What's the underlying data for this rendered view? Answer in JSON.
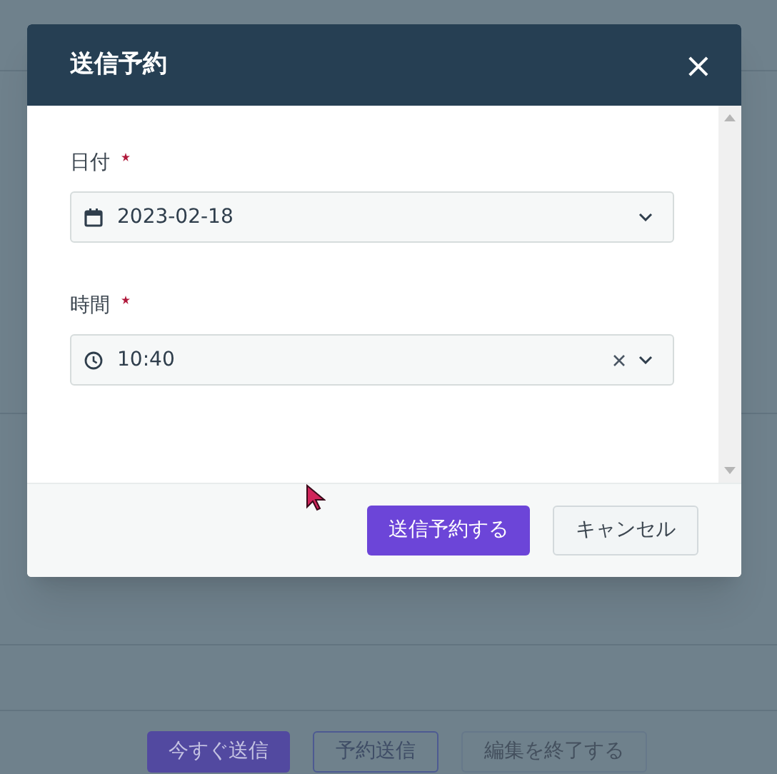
{
  "dialog": {
    "title": "送信予約",
    "close_label": "×",
    "fields": [
      {
        "label": "日付",
        "required": true,
        "kind": "date",
        "value": "2023-02-18",
        "clearable": false
      },
      {
        "label": "時間",
        "required": true,
        "kind": "time",
        "value": "10:40",
        "clearable": true
      }
    ],
    "buttons": [
      {
        "label": "送信予約する",
        "kind": "primary"
      },
      {
        "label": "キャンセル",
        "kind": "secondary"
      }
    ]
  },
  "background_buttons": [
    {
      "label": "今すぐ送信",
      "kind": "primary"
    },
    {
      "label": "予約送信",
      "kind": "outline"
    },
    {
      "label": "編集を終了する",
      "kind": "plain"
    }
  ]
}
